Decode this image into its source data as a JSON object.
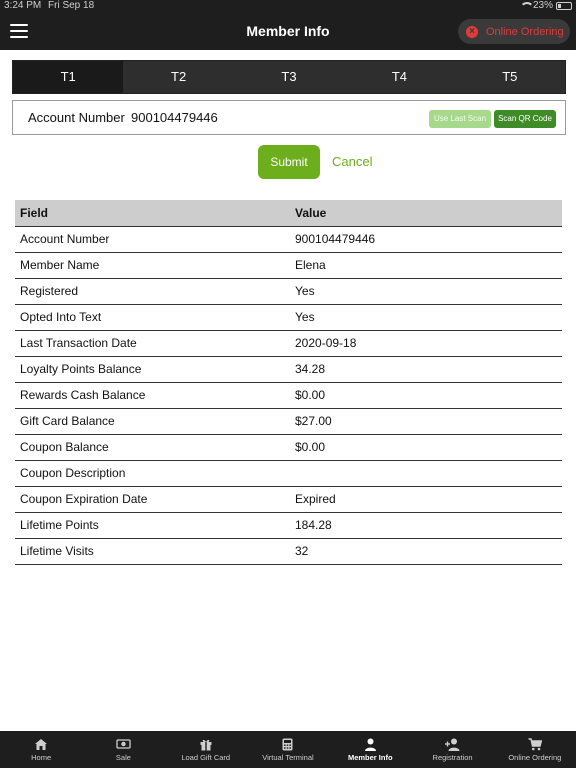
{
  "status": {
    "time": "3:24 PM",
    "date": "Fri Sep 18",
    "battery": "23%",
    "battery_level": 0.23
  },
  "header": {
    "title": "Member Info",
    "online_ordering": "Online Ordering"
  },
  "tabs": [
    {
      "label": "T1",
      "active": true
    },
    {
      "label": "T2",
      "active": false
    },
    {
      "label": "T3",
      "active": false
    },
    {
      "label": "T4",
      "active": false
    },
    {
      "label": "T5",
      "active": false
    }
  ],
  "account": {
    "label": "Account Number",
    "value": "900104479446",
    "use_last_scan": "Use Last Scan",
    "scan_qr": "Scan QR Code"
  },
  "actions": {
    "submit": "Submit",
    "cancel": "Cancel"
  },
  "table": {
    "headers": [
      "Field",
      "Value"
    ],
    "rows": [
      [
        "Account Number",
        "900104479446"
      ],
      [
        "Member Name",
        "Elena"
      ],
      [
        "Registered",
        "Yes"
      ],
      [
        "Opted Into Text",
        "Yes"
      ],
      [
        "Last Transaction Date",
        "2020-09-18"
      ],
      [
        "Loyalty Points Balance",
        "34.28"
      ],
      [
        "Rewards Cash Balance",
        "$0.00"
      ],
      [
        "Gift Card Balance",
        "$27.00"
      ],
      [
        "Coupon Balance",
        "$0.00"
      ],
      [
        "Coupon Description",
        ""
      ],
      [
        "Coupon Expiration Date",
        "Expired"
      ],
      [
        "Lifetime Points",
        "184.28"
      ],
      [
        "Lifetime Visits",
        "32"
      ]
    ]
  },
  "nav": [
    {
      "label": "Home",
      "icon": "home-icon",
      "active": false
    },
    {
      "label": "Sale",
      "icon": "cash-icon",
      "active": false
    },
    {
      "label": "Load Gift Card",
      "icon": "gift-icon",
      "active": false
    },
    {
      "label": "Virtual Terminal",
      "icon": "calculator-icon",
      "active": false
    },
    {
      "label": "Member Info",
      "icon": "person-icon",
      "active": true
    },
    {
      "label": "Registration",
      "icon": "add-person-icon",
      "active": false
    },
    {
      "label": "Online Ordering",
      "icon": "cart-icon",
      "active": false
    }
  ]
}
